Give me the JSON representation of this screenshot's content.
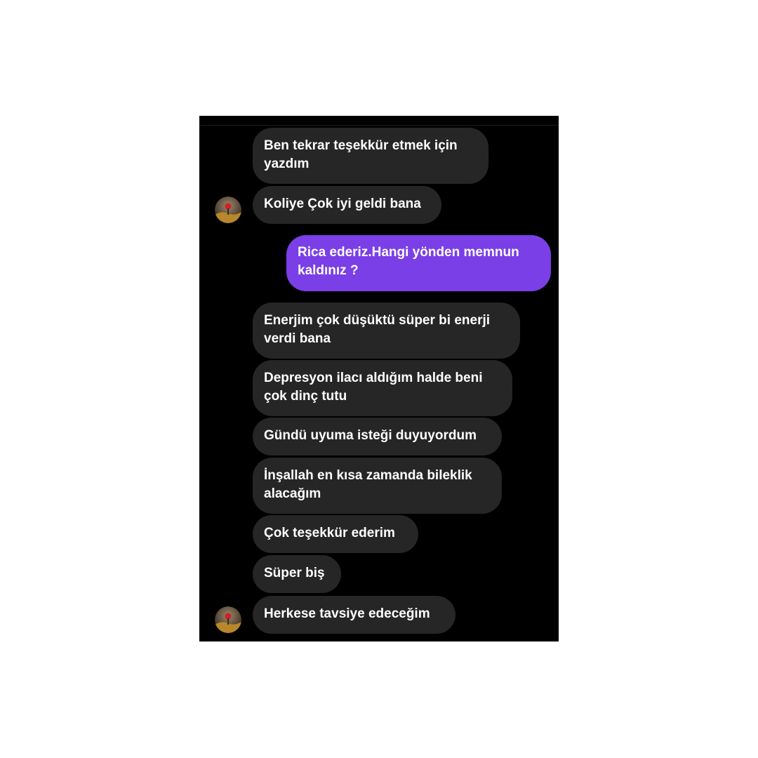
{
  "messages": [
    {
      "sender": "them",
      "text": "Ben tekrar teşekkür etmek için\nyazdım"
    },
    {
      "sender": "them",
      "text": "Koliye Çok iyi geldi bana"
    },
    {
      "sender": "me",
      "text": "Rica ederiz.Hangi yönden memnun\nkaldınız ?"
    },
    {
      "sender": "them",
      "text": "Enerjim çok düşüktü süper bi enerji\nverdi bana"
    },
    {
      "sender": "them",
      "text": "Depresyon ilacı aldığım halde beni\nçok dinç tutu"
    },
    {
      "sender": "them",
      "text": "Gündü uyuma isteği duyuyordum"
    },
    {
      "sender": "them",
      "text": "İnşallah en kısa zamanda bileklik\nalacağım"
    },
    {
      "sender": "them",
      "text": "Çok teşekkür ederim"
    },
    {
      "sender": "them",
      "text": "Süper biş"
    },
    {
      "sender": "them",
      "text": "Herkese tavsiye edeceğim"
    }
  ],
  "colors": {
    "background": "#000000",
    "incoming_bubble": "#262626",
    "outgoing_bubble": "#7a3fe6",
    "text": "#ffffff"
  }
}
